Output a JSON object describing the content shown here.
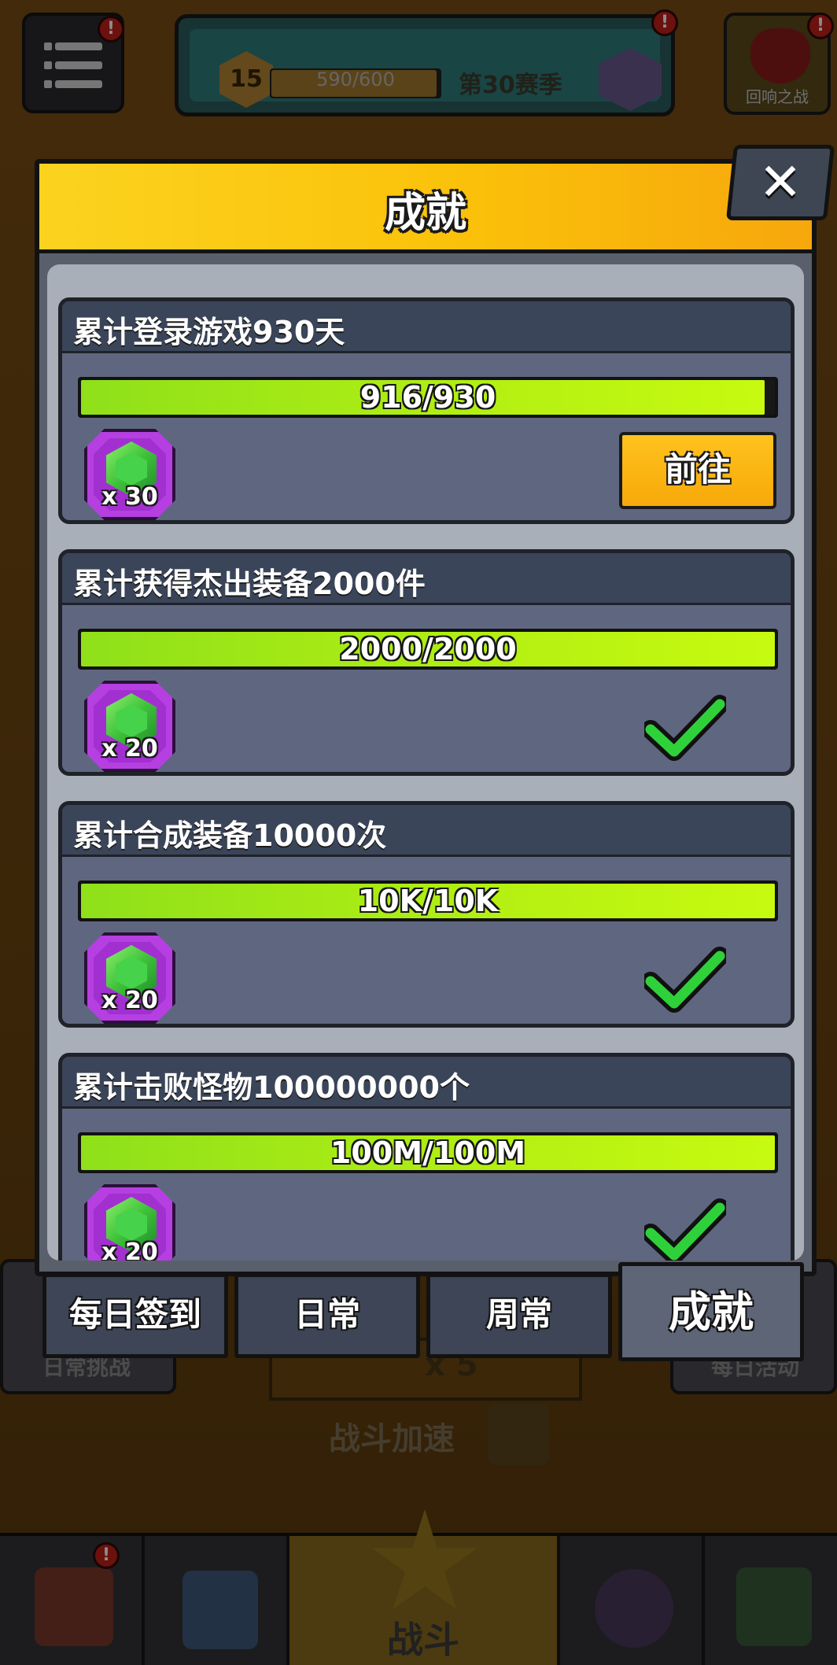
{
  "hud": {
    "level": "15",
    "xp": "590/600",
    "xp_fraction": 0.983,
    "season": "第30赛季",
    "event_label": "回响之战",
    "badge_mark": "!"
  },
  "modal": {
    "title": "成就",
    "close_label": "✕",
    "achievements": [
      {
        "title": "累计登录游戏930天",
        "progress": "916/930",
        "fraction": 0.985,
        "reward_qty": "x 30",
        "status": "goto",
        "button_label": "前往"
      },
      {
        "title": "累计获得杰出装备2000件",
        "progress": "2000/2000",
        "fraction": 1.0,
        "reward_qty": "x 20",
        "status": "done"
      },
      {
        "title": "累计合成装备10000次",
        "progress": "10K/10K",
        "fraction": 1.0,
        "reward_qty": "x 20",
        "status": "done"
      },
      {
        "title": "累计击败怪物100000000个",
        "progress": "100M/100M",
        "fraction": 1.0,
        "reward_qty": "x 20",
        "status": "done"
      }
    ]
  },
  "tabs": [
    {
      "label": "每日签到",
      "active": false
    },
    {
      "label": "日常",
      "active": false
    },
    {
      "label": "周常",
      "active": false
    },
    {
      "label": "成就",
      "active": true
    }
  ],
  "background": {
    "daily_challenge": "日常挑战",
    "daily_event": "每日活动",
    "speed_multiplier": "x 5",
    "speed_label": "战斗加速",
    "battle_label": "战斗"
  },
  "colors": {
    "header_yellow": "#fbc10a",
    "progress_green": "#b4f012",
    "reward_purple": "#b53fe0",
    "check_green": "#2fd13a",
    "goto_orange": "#f7a90a"
  }
}
